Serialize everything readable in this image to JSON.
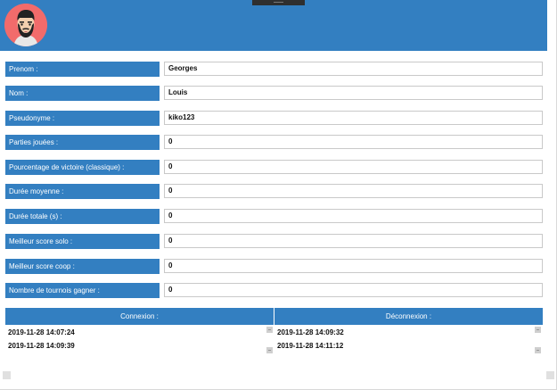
{
  "avatar": {
    "icon": "bearded-man-icon",
    "accent": "#f26b6b"
  },
  "colors": {
    "brand": "#337fc1"
  },
  "profile": {
    "fields": [
      {
        "label": "Prenom :",
        "value": "Georges"
      },
      {
        "label": "Nom :",
        "value": "Louis"
      },
      {
        "label": "Pseudonyme :",
        "value": "kiko123"
      },
      {
        "label": "Parties jouées :",
        "value": "0"
      },
      {
        "label": "Pourcentage de victoire (classique) :",
        "value": "0"
      },
      {
        "label": "Durée moyenne :",
        "value": "0"
      },
      {
        "label": "Durée totale (s) :",
        "value": "0"
      },
      {
        "label": "Meilleur score solo :",
        "value": "0"
      },
      {
        "label": "Meilleur score coop :",
        "value": "0"
      },
      {
        "label": "Nombre de tournois gagner :",
        "value": "0"
      }
    ]
  },
  "history": {
    "connexion_header": "Connexion :",
    "deconnexion_header": "Déconnexion :",
    "connexions": [
      "2019-11-28 14:07:24",
      "2019-11-28 14:09:39"
    ],
    "deconnexions": [
      "2019-11-28 14:09:32",
      "2019-11-28 14:11:12"
    ]
  }
}
